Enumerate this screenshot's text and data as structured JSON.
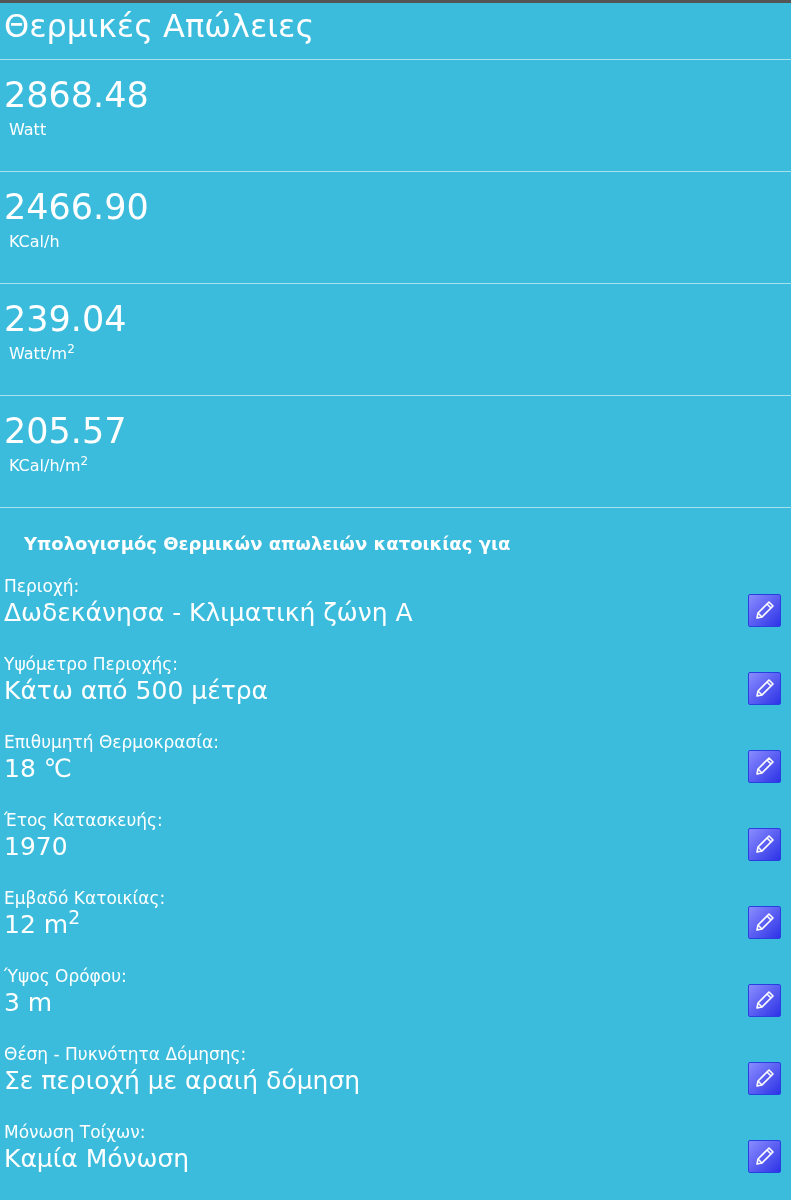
{
  "title": "Θερμικές Απώλειες",
  "results": [
    {
      "value": "2868.48",
      "unit": "Watt"
    },
    {
      "value": "2466.90",
      "unit": "KCal/h"
    },
    {
      "value": "239.04",
      "unit": "Watt/m$^{2}$"
    },
    {
      "value": "205.57",
      "unit": "KCal/h/m$^{2}$"
    }
  ],
  "inputs_heading": "Υπολογισμός Θερμικών απωλειών κατοικίας για",
  "inputs": [
    {
      "label": "Περιοχή:",
      "value": "Δωδεκάνησα - Κλιματική ζώνη Α"
    },
    {
      "label": "Υψόμετρο Περιοχής:",
      "value": "Κάτω από 500 μέτρα"
    },
    {
      "label": "Επιθυμητή Θερμοκρασία:",
      "value": "18 ℃"
    },
    {
      "label": "Έτος Κατασκευής:",
      "value": "1970"
    },
    {
      "label": "Εμβαδό Κατοικίας:",
      "value": "12 m$^{2}$"
    },
    {
      "label": "Ύψος Ορόφου:",
      "value": "3 m"
    },
    {
      "label": "Θέση - Πυκνότητα Δόμησης:",
      "value": "Σε περιοχή με αραιή δόμηση"
    },
    {
      "label": "Μόνωση Τοίχων:",
      "value": "Καμία Μόνωση"
    }
  ]
}
